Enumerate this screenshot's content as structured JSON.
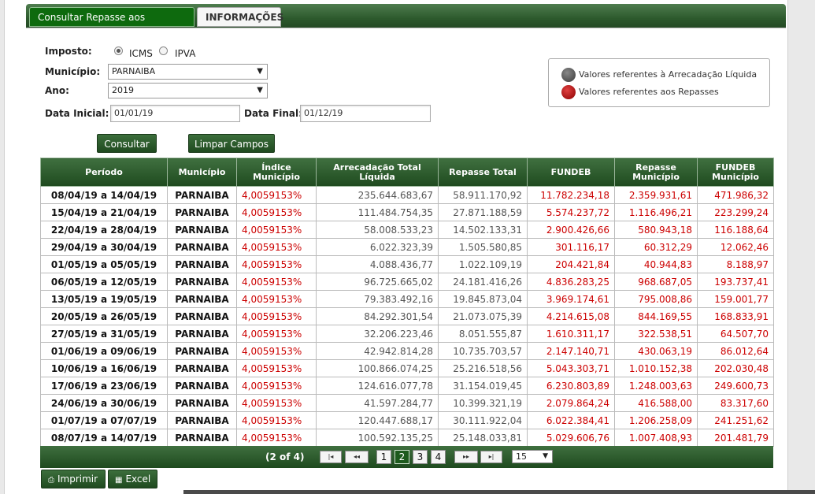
{
  "tabs": [
    {
      "label": "Consultar Repasse aos Municípios",
      "active": true
    },
    {
      "label": "INFORMAÇÕES",
      "active": false
    }
  ],
  "form": {
    "imposto_label": "Imposto:",
    "imposto_options": [
      {
        "label": "ICMS",
        "selected": true
      },
      {
        "label": "IPVA",
        "selected": false
      }
    ],
    "municipio_label": "Município:",
    "municipio_value": "PARNAIBA",
    "ano_label": "Ano:",
    "ano_value": "2019",
    "data_inicial_label": "Data Inicial:",
    "data_inicial_value": "01/01/19",
    "data_final_label": "Data Final:",
    "data_final_value": "01/12/19",
    "consultar_label": "Consultar",
    "limpar_label": "Limpar Campos"
  },
  "legend": {
    "items": [
      {
        "color": "gray",
        "label": "Valores referentes à Arrecadação Líquida"
      },
      {
        "color": "red",
        "label": "Valores referentes aos Repasses"
      }
    ]
  },
  "table": {
    "headers": [
      "Período",
      "Município",
      "Índice Município",
      "Arrecadação Total Líquida",
      "Repasse Total",
      "FUNDEB",
      "Repasse Município",
      "FUNDEB Município"
    ],
    "rows": [
      [
        "08/04/19 a 14/04/19",
        "PARNAIBA",
        "4,0059153%",
        "235.644.683,67",
        "58.911.170,92",
        "11.782.234,18",
        "2.359.931,61",
        "471.986,32"
      ],
      [
        "15/04/19 a 21/04/19",
        "PARNAIBA",
        "4,0059153%",
        "111.484.754,35",
        "27.871.188,59",
        "5.574.237,72",
        "1.116.496,21",
        "223.299,24"
      ],
      [
        "22/04/19 a 28/04/19",
        "PARNAIBA",
        "4,0059153%",
        "58.008.533,23",
        "14.502.133,31",
        "2.900.426,66",
        "580.943,18",
        "116.188,64"
      ],
      [
        "29/04/19 a 30/04/19",
        "PARNAIBA",
        "4,0059153%",
        "6.022.323,39",
        "1.505.580,85",
        "301.116,17",
        "60.312,29",
        "12.062,46"
      ],
      [
        "01/05/19 a 05/05/19",
        "PARNAIBA",
        "4,0059153%",
        "4.088.436,77",
        "1.022.109,19",
        "204.421,84",
        "40.944,83",
        "8.188,97"
      ],
      [
        "06/05/19 a 12/05/19",
        "PARNAIBA",
        "4,0059153%",
        "96.725.665,02",
        "24.181.416,26",
        "4.836.283,25",
        "968.687,05",
        "193.737,41"
      ],
      [
        "13/05/19 a 19/05/19",
        "PARNAIBA",
        "4,0059153%",
        "79.383.492,16",
        "19.845.873,04",
        "3.969.174,61",
        "795.008,86",
        "159.001,77"
      ],
      [
        "20/05/19 a 26/05/19",
        "PARNAIBA",
        "4,0059153%",
        "84.292.301,54",
        "21.073.075,39",
        "4.214.615,08",
        "844.169,55",
        "168.833,91"
      ],
      [
        "27/05/19 a 31/05/19",
        "PARNAIBA",
        "4,0059153%",
        "32.206.223,46",
        "8.051.555,87",
        "1.610.311,17",
        "322.538,51",
        "64.507,70"
      ],
      [
        "01/06/19 a 09/06/19",
        "PARNAIBA",
        "4,0059153%",
        "42.942.814,28",
        "10.735.703,57",
        "2.147.140,71",
        "430.063,19",
        "86.012,64"
      ],
      [
        "10/06/19 a 16/06/19",
        "PARNAIBA",
        "4,0059153%",
        "100.866.074,25",
        "25.216.518,56",
        "5.043.303,71",
        "1.010.152,38",
        "202.030,48"
      ],
      [
        "17/06/19 a 23/06/19",
        "PARNAIBA",
        "4,0059153%",
        "124.616.077,78",
        "31.154.019,45",
        "6.230.803,89",
        "1.248.003,63",
        "249.600,73"
      ],
      [
        "24/06/19 a 30/06/19",
        "PARNAIBA",
        "4,0059153%",
        "41.597.284,77",
        "10.399.321,19",
        "2.079.864,24",
        "416.588,00",
        "83.317,60"
      ],
      [
        "01/07/19 a 07/07/19",
        "PARNAIBA",
        "4,0059153%",
        "120.447.688,17",
        "30.111.922,04",
        "6.022.384,41",
        "1.206.258,09",
        "241.251,62"
      ],
      [
        "08/07/19 a 14/07/19",
        "PARNAIBA",
        "4,0059153%",
        "100.592.135,25",
        "25.148.033,81",
        "5.029.606,76",
        "1.007.408,93",
        "201.481,79"
      ]
    ]
  },
  "pager": {
    "status": "(2 of 4)",
    "first": "|◂",
    "prev": "◂◂",
    "next": "▸▸",
    "last": "▸|",
    "pages": [
      "1",
      "2",
      "3",
      "4"
    ],
    "current_page": "2",
    "page_size": "15"
  },
  "footer": {
    "print_label": "Imprimir",
    "excel_label": "Excel"
  }
}
